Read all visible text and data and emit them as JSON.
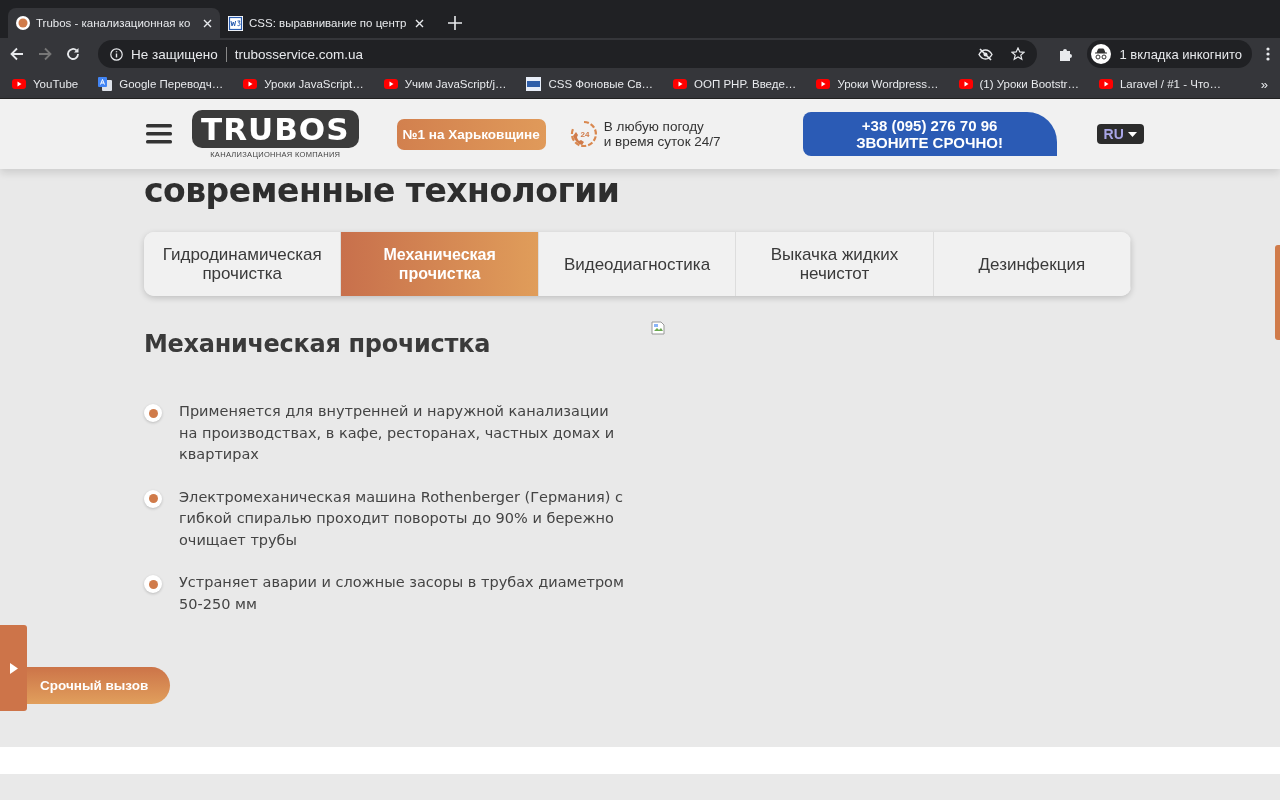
{
  "browser": {
    "tabs": [
      {
        "title": "Trubos - канализационная ко",
        "kind": "site",
        "selected": true
      },
      {
        "title": "CSS: выравнивание по центр",
        "kind": "w3",
        "selected": false
      }
    ],
    "security": "Не защищено",
    "url": "trubosservice.com.ua",
    "profile": "1 вкладка инкогнито",
    "bookmarks": [
      {
        "title": "YouTube",
        "kind": "video"
      },
      {
        "title": "Google Переводч…",
        "kind": "translate"
      },
      {
        "title": "Уроки JavaScript…",
        "kind": "video"
      },
      {
        "title": "Учим JavaScript/j…",
        "kind": "video"
      },
      {
        "title": "CSS Фоновые Св…",
        "kind": "css"
      },
      {
        "title": "ООП PHP. Введе…",
        "kind": "video"
      },
      {
        "title": "Уроки Wordpress…",
        "kind": "video"
      },
      {
        "title": "(1) Уроки Bootstr…",
        "kind": "video"
      },
      {
        "title": "Laravel / #1 - Что…",
        "kind": "video"
      }
    ],
    "more": "»"
  },
  "header": {
    "logo": "TRUBOS",
    "logo_subtitle": "КАНАЛИЗАЦИОННАЯ КОМПАНИЯ",
    "badge": "№1 на Харьковщине",
    "hours_icon": "24",
    "hours": "В любую погоду\nи время суток 24/7",
    "phone": "+38 (095) 276 70 96",
    "call_label": "ЗВОНИТЕ СРОЧНО!",
    "language": "RU"
  },
  "heading": "современные технологии",
  "service_tabs": [
    {
      "label": "Гидродинамическая прочистка",
      "selected": false
    },
    {
      "label": "Механическая прочистка",
      "selected": true
    },
    {
      "label": "Видеодиагностика",
      "selected": false
    },
    {
      "label": "Выкачка жидких нечистот",
      "selected": false
    },
    {
      "label": "Дезинфекция",
      "selected": false
    }
  ],
  "panel": {
    "title": "Механическая прочистка",
    "points": [
      "Применяется для внутренней и наружной канализации на производствах, в кафе, ресторанах, частных домах и квартирах",
      "Электромеханическая машина Rothenberger (Германия) с гибкой спиралью проходит повороты до 90% и бережно очищает трубы",
      "Устраняет аварии и сложные засоры в трубах диаметром 50-250 мм"
    ]
  },
  "urgent_call": "Срочный вызов"
}
